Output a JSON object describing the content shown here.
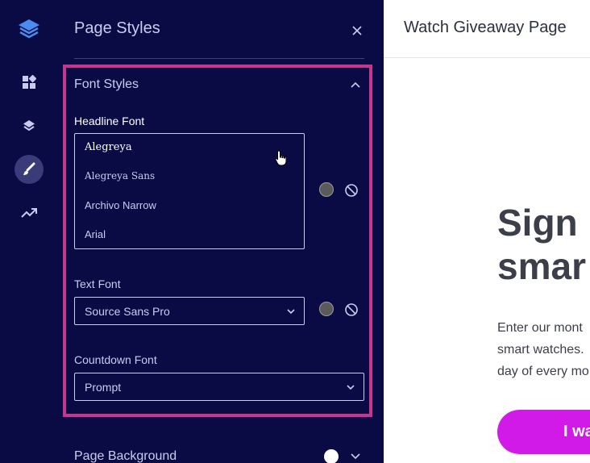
{
  "panel": {
    "title": "Page Styles",
    "font_styles": {
      "title": "Font Styles",
      "headline_label": "Headline Font",
      "headline_options": [
        "Alegreya",
        "Alegreya Sans",
        "Archivo Narrow",
        "Arial"
      ],
      "selected_headline": "Alegreya",
      "text_label": "Text Font",
      "text_value": "Source Sans Pro",
      "countdown_label": "Countdown Font",
      "countdown_value": "Prompt"
    },
    "page_background": {
      "title": "Page Background"
    }
  },
  "preview": {
    "title": "Watch Giveaway Page",
    "headline_lines": [
      "Sign",
      "smar"
    ],
    "body_lines": [
      "Enter our mont",
      "smart watches.",
      "day of every mo"
    ],
    "cta_label": "I wa"
  },
  "colors": {
    "rail_bg": "#0a0b45",
    "panel_text": "#c9ccee",
    "highlight_border": "#c7358f",
    "cta_bg": "#d21ae8",
    "headline_color": "#3c3f4a"
  },
  "icons": {
    "rail": [
      "layers-logo-icon",
      "dashboard-icon",
      "layers-icon",
      "brush-icon",
      "trending-up-icon"
    ],
    "panel": [
      "close-icon",
      "chevron-up-icon",
      "chevron-down-icon",
      "color-swatch-icon",
      "no-color-icon",
      "hand-cursor-icon"
    ]
  }
}
